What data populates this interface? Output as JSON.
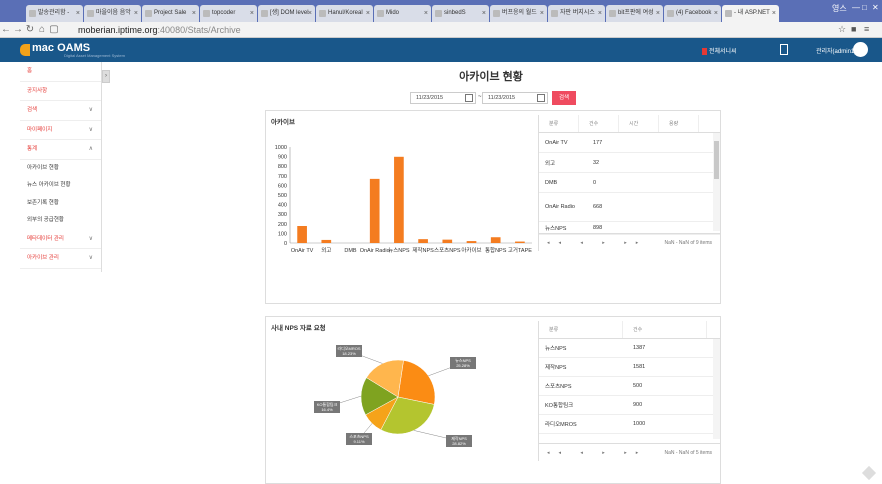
{
  "browser": {
    "tabs": [
      {
        "label": "발송관리함 -"
      },
      {
        "label": "마을이음 음악"
      },
      {
        "label": "Project Sale"
      },
      {
        "label": "topcoder"
      },
      {
        "label": "[생] DOM level"
      },
      {
        "label": "Hanul/Koreal"
      },
      {
        "label": "Mido"
      },
      {
        "label": "sinbedS"
      },
      {
        "label": "버프응의 월드"
      },
      {
        "label": "자판 버지시스"
      },
      {
        "label": "bit프판에 여성"
      },
      {
        "label": "(4) Facebook"
      },
      {
        "label": "- 내 ASP.NET"
      }
    ],
    "user_badge": "영스",
    "url_host": "moberian.iptime.org",
    "url_path": ":40080/Stats/Archive"
  },
  "app": {
    "logo": "mac OAMS",
    "logo_sub": "Digital Asset Management System",
    "monitor_label": "전체서니씨",
    "user_label": "관리자(admin1)"
  },
  "sidebar": {
    "items": [
      {
        "label": "홈"
      },
      {
        "label": "공지사항"
      },
      {
        "label": "검색"
      },
      {
        "label": "마이페이지"
      },
      {
        "label": "통계"
      },
      {
        "label": "아카이브 현황"
      },
      {
        "label": "뉴스 아카이브 현황"
      },
      {
        "label": "보존기록 현황"
      },
      {
        "label": "외부의 공급현황"
      },
      {
        "label": "메타데이터 관리"
      },
      {
        "label": "아카이브 관리"
      }
    ]
  },
  "main": {
    "title": "아카이브 현황",
    "date_from": "11/23/2015",
    "date_to": "11/23/2015",
    "dash": "~",
    "search_label": "검색"
  },
  "archive": {
    "panel_title": "아카이브",
    "table_headers": [
      "분류",
      "건수",
      "시간",
      "용량"
    ],
    "rows": [
      {
        "category": "OnAir TV",
        "count": "177"
      },
      {
        "category": "외고",
        "count": "32"
      },
      {
        "category": "DMB",
        "count": "0"
      },
      {
        "category": "OnAir Radio",
        "count": "668"
      },
      {
        "category": "뉴스NPS",
        "count": "898"
      }
    ],
    "pager_info": "NaN - NaN of 9 items"
  },
  "nps": {
    "panel_title": "사내 NPS 자료 요청",
    "table_headers": [
      "분류",
      "건수"
    ],
    "rows": [
      {
        "category": "뉴스NPS",
        "count": "1387"
      },
      {
        "category": "제작NPS",
        "count": "1581"
      },
      {
        "category": "스포츠NPS",
        "count": "500"
      },
      {
        "category": "KO통합팀크",
        "count": "900"
      },
      {
        "category": "라디오MROS",
        "count": "1000"
      }
    ],
    "pager_info": "NaN - NaN of 5 items"
  },
  "chart_data": [
    {
      "type": "bar",
      "categories": [
        "OnAir TV",
        "외고",
        "DMB",
        "OnAir Radio",
        "뉴스NPS",
        "제작NPS",
        "스포츠NPS",
        "아카이브",
        "통합NPS",
        "고거TAPE"
      ],
      "values": [
        177,
        32,
        0,
        668,
        898,
        40,
        35,
        20,
        60,
        15
      ],
      "ylim": [
        0,
        1000
      ],
      "yticks": [
        0,
        100,
        200,
        300,
        400,
        500,
        600,
        700,
        800,
        900,
        1000
      ],
      "color": "#f47c20",
      "grid": false
    },
    {
      "type": "pie",
      "slices": [
        {
          "label": "뉴스NPS",
          "pct": "25.28%",
          "value": 1387,
          "color": "#fb8c14"
        },
        {
          "label": "제작NPS",
          "pct": "28.82%",
          "value": 1581,
          "color": "#b4c52f"
        },
        {
          "label": "스포츠NPS",
          "pct": "9.11%",
          "value": 500,
          "color": "#f5a31a"
        },
        {
          "label": "KO통합팀크",
          "pct": "16.4%",
          "value": 900,
          "color": "#7fa320"
        },
        {
          "label": "라디오MROS",
          "pct": "18.23%",
          "value": 1000,
          "color": "#ffb64d"
        }
      ]
    }
  ]
}
